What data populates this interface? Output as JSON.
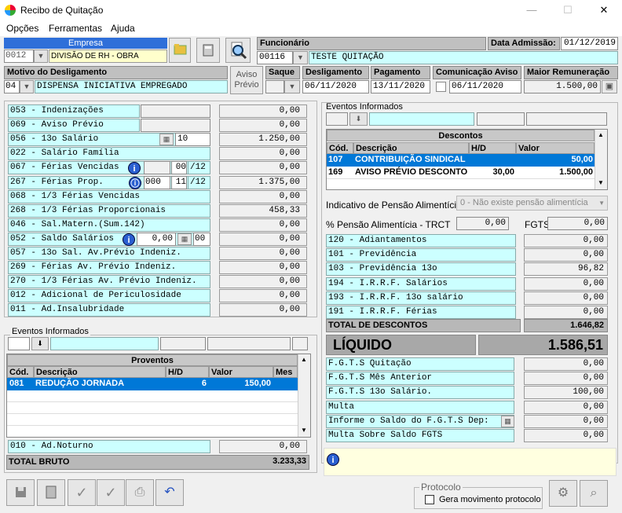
{
  "window": {
    "title": "Recibo de Quitação",
    "minimize": "—",
    "maximize": "☐",
    "close": "✕"
  },
  "menu": {
    "opcoes": "Opções",
    "ferramentas": "Ferramentas",
    "ajuda": "Ajuda"
  },
  "empresa": {
    "label": "Empresa",
    "code": "0012",
    "name": "DIVISÃO DE RH - OBRA"
  },
  "funcionario": {
    "label": "Funcionário",
    "code": "00116",
    "name": "TESTE QUITAÇÃO"
  },
  "admissao": {
    "label": "Data Admissão:",
    "value": "01/12/2019"
  },
  "motivo": {
    "label": "Motivo do Desligamento",
    "code": "04",
    "text": "DISPENSA INICIATIVA EMPREGADO"
  },
  "aviso_button": "Aviso\nPrévio",
  "saque": {
    "label": "Saque"
  },
  "desligamento": {
    "label": "Desligamento",
    "value": "06/11/2020"
  },
  "pagamento": {
    "label": "Pagamento",
    "value": "13/11/2020"
  },
  "comunicacao": {
    "label": "Comunicação Aviso",
    "value": "06/11/2020"
  },
  "maior_remuneracao": {
    "label": "Maior Remuneração",
    "value": "1.500,00"
  },
  "verbas": [
    {
      "label": "053 - Indenizações",
      "value": "0,00"
    },
    {
      "label": "069 - Aviso Prévio",
      "value": "0,00"
    },
    {
      "label": "056 - 13o Salário",
      "extra": "10",
      "value": "1.250,00"
    },
    {
      "label": "022 - Salário Família",
      "value": "0,00"
    },
    {
      "label": "067 - Férias Vencidas",
      "m1": "00",
      "m2": "/12",
      "value": "0,00"
    },
    {
      "label": "267 - Férias Prop.",
      "m0": "000",
      "m1": "11",
      "m2": "/12",
      "value": "1.375,00"
    },
    {
      "label": "068 - 1/3 Férias Vencidas",
      "value": "0,00"
    },
    {
      "label": "268 - 1/3 Férias Proporcionais",
      "value": "458,33"
    },
    {
      "label": "046 - Sal.Matern.(Sum.142)",
      "value": "0,00"
    },
    {
      "label": "052 - Saldo Salários",
      "v2": "0,00",
      "m1": "00",
      "value": "0,00"
    },
    {
      "label": "057 - 13o Sal. Av.Prévio Indeniz.",
      "value": "0,00"
    },
    {
      "label": "269 -  Férias  Av. Prévio Indeniz.",
      "value": "0,00"
    },
    {
      "label": "270 -  1/3 Férias Av. Prévio Indeniz.",
      "value": "0,00"
    },
    {
      "label": "012 - Adicional de Periculosidade",
      "value": "0,00"
    },
    {
      "label": "011 - Ad.Insalubridade",
      "value": "0,00"
    }
  ],
  "eventos_left": {
    "label": "Eventos Informados"
  },
  "proventos": {
    "title": "Proventos",
    "headers": [
      "Cód.",
      "Descrição",
      "H/D",
      "Valor",
      "Mes"
    ],
    "rows": [
      {
        "cod": "081",
        "desc": "REDUÇÃO JORNADA",
        "hd": "6",
        "valor": "150,00",
        "mes": ""
      }
    ]
  },
  "ad_noturno": {
    "label": "010 - Ad.Noturno",
    "value": "0,00"
  },
  "total_bruto": {
    "label": "TOTAL BRUTO",
    "value": "3.233,33"
  },
  "eventos_right": {
    "label": "Eventos Informados"
  },
  "descontos": {
    "title": "Descontos",
    "headers": [
      "Cód.",
      "Descrição",
      "H/D",
      "Valor"
    ],
    "rows": [
      {
        "cod": "107",
        "desc": "CONTRIBUIÇÃO SINDICAL",
        "hd": "",
        "valor": "50,00"
      },
      {
        "cod": "169",
        "desc": "AVISO PRÉVIO DESCONTO",
        "hd": "30,00",
        "valor": "1.500,00"
      }
    ]
  },
  "pensao": {
    "label": "Indicativo de Pensão Alimentícia",
    "value": "0 - Não existe pensão alimentícia"
  },
  "pct_pensao": {
    "label": "% Pensão Alimentícia - TRCT",
    "value": "0,00"
  },
  "fgts_field": {
    "label": "FGTS",
    "value": "0,00"
  },
  "deducoes": [
    {
      "label": "120 - Adiantamentos",
      "value": "0,00"
    },
    {
      "label": "101 - Previdência",
      "value": "0,00"
    },
    {
      "label": "103 - Previdência 13o",
      "value": "96,82"
    },
    {
      "label": "194 - I.R.R.F. Salários",
      "value": "0,00"
    },
    {
      "label": "193 - I.R.R.F. 13o salário",
      "value": "0,00"
    },
    {
      "label": "191 - I.R.R.F. Férias",
      "value": "0,00"
    }
  ],
  "total_descontos": {
    "label": "TOTAL DE DESCONTOS",
    "value": "1.646,82"
  },
  "liquido": {
    "label": "LÍQUIDO",
    "value": "1.586,51"
  },
  "fgts_rows": [
    {
      "label": "F.G.T.S  Quitação",
      "value": "0,00"
    },
    {
      "label": "F.G.T.S  Mês Anterior",
      "value": "0,00"
    },
    {
      "label": "F.G.T.S  13o Salário.",
      "value": "100,00"
    },
    {
      "label": "Multa",
      "value": "0,00"
    },
    {
      "label": "Informe o Saldo do F.G.T.S Dep:",
      "value": "0,00"
    },
    {
      "label": "Multa Sobre Saldo FGTS",
      "value": "0,00"
    }
  ],
  "protocolo": {
    "label": "Protocolo",
    "checkbox": "Gera movimento protocolo"
  },
  "colors": {
    "cyan": "#ccffff",
    "selection": "#0078d7",
    "header_blue": "#2f6fd9"
  }
}
